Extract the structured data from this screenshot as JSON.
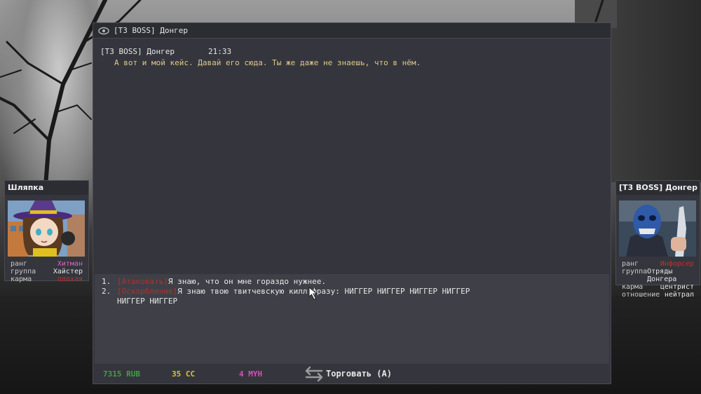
{
  "window": {
    "title": "[T3 BOSS] Донгер",
    "icon": "eye-icon"
  },
  "log": {
    "speaker": "[T3 BOSS] Донгер",
    "time": "21:33",
    "message": "А вот и мой кейс. Давай его сюда. Ты же даже не знаешь, что в нём."
  },
  "answers": [
    {
      "num": "1.",
      "tag": "[Атаковать]",
      "text": "Я знаю, что он мне гораздо нужнее."
    },
    {
      "num": "2.",
      "tag": "[Оскорбление]",
      "text": "Я знаю твою твитчевскую килл-фразу: НИГГЕР НИГГЕР НИГГЕР НИГГЕР НИГГЕР НИГГЕР"
    }
  ],
  "footer": {
    "rub": "7315 RUB",
    "cc": "35 CC",
    "myh": "4 MYH",
    "trade": "Торговать (A)"
  },
  "player": {
    "name": "Шляпка",
    "rank_label": "ранг",
    "rank": "Хитман",
    "group_label": "группа",
    "group": "Хайстер",
    "karma_label": "карма",
    "karma": "плохая"
  },
  "npc": {
    "name": "[T3 BOSS] Донгер",
    "rank_label": "ранг",
    "rank": "Инфорсер",
    "group_label": "группа",
    "group": "Отряды Донгера",
    "karma_label": "карма",
    "karma": "центрист",
    "attitude_label": "отношение",
    "attitude": "нейтрал"
  },
  "colors": {
    "rub": "#3fa03f",
    "cc": "#e0c030",
    "myh": "#d050c0",
    "tag": "#b03030",
    "message": "#e0c88a"
  }
}
